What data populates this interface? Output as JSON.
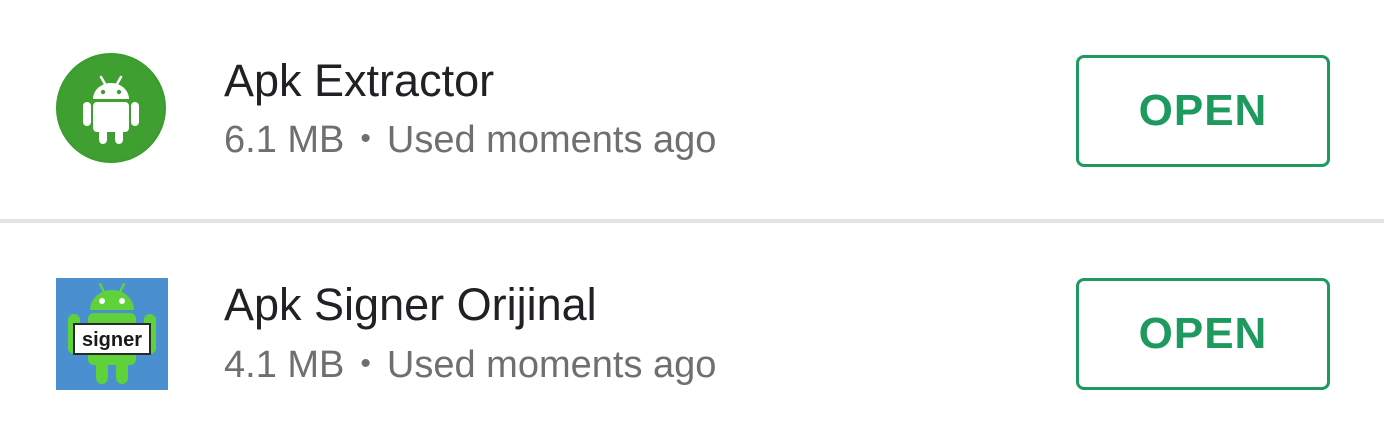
{
  "apps": [
    {
      "name": "Apk Extractor",
      "size": "6.1 MB",
      "separator": "•",
      "status": "Used moments ago",
      "icon": "android-robot-green-circle-icon",
      "icon_color": "#3a9b2e",
      "button_label": "OPEN"
    },
    {
      "name": "Apk Signer Orijinal",
      "size": "4.1 MB",
      "separator": "•",
      "status": "Used moments ago",
      "icon": "android-signer-icon",
      "icon_text": "signer",
      "icon_color": "#4a8fd0",
      "button_label": "OPEN"
    }
  ],
  "colors": {
    "accent": "#1e9a5e",
    "title_text": "#202124",
    "secondary_text": "#6f6f6f",
    "divider": "#e4e4e4"
  }
}
